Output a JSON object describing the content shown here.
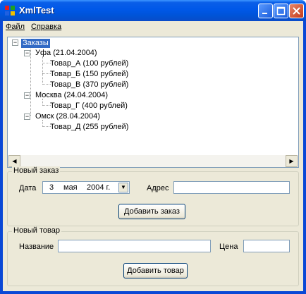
{
  "window": {
    "title": "XmlTest"
  },
  "menu": {
    "file": "Файл",
    "help": "Справка"
  },
  "tree": {
    "root": "Заказы",
    "cities": [
      {
        "label": "Уфа (21.04.2004)",
        "items": [
          "Товар_А (100 рублей)",
          "Товар_Б (150 рублей)",
          "Товар_В (370 рублей)"
        ]
      },
      {
        "label": "Москва (24.04.2004)",
        "items": [
          "Товар_Г (400 рублей)"
        ]
      },
      {
        "label": "Омск (28.04.2004)",
        "items": [
          "Товар_Д (255 рублей)"
        ]
      }
    ]
  },
  "new_order": {
    "group_title": "Новый заказ",
    "date_label": "Дата",
    "date_day": "3",
    "date_month": "мая",
    "date_year": "2004 г.",
    "address_label": "Адрес",
    "address_value": "",
    "add_button": "Добавить заказ"
  },
  "new_product": {
    "group_title": "Новый товар",
    "name_label": "Название",
    "name_value": "",
    "price_label": "Цена",
    "price_value": "",
    "add_button": "Добавить товар"
  }
}
